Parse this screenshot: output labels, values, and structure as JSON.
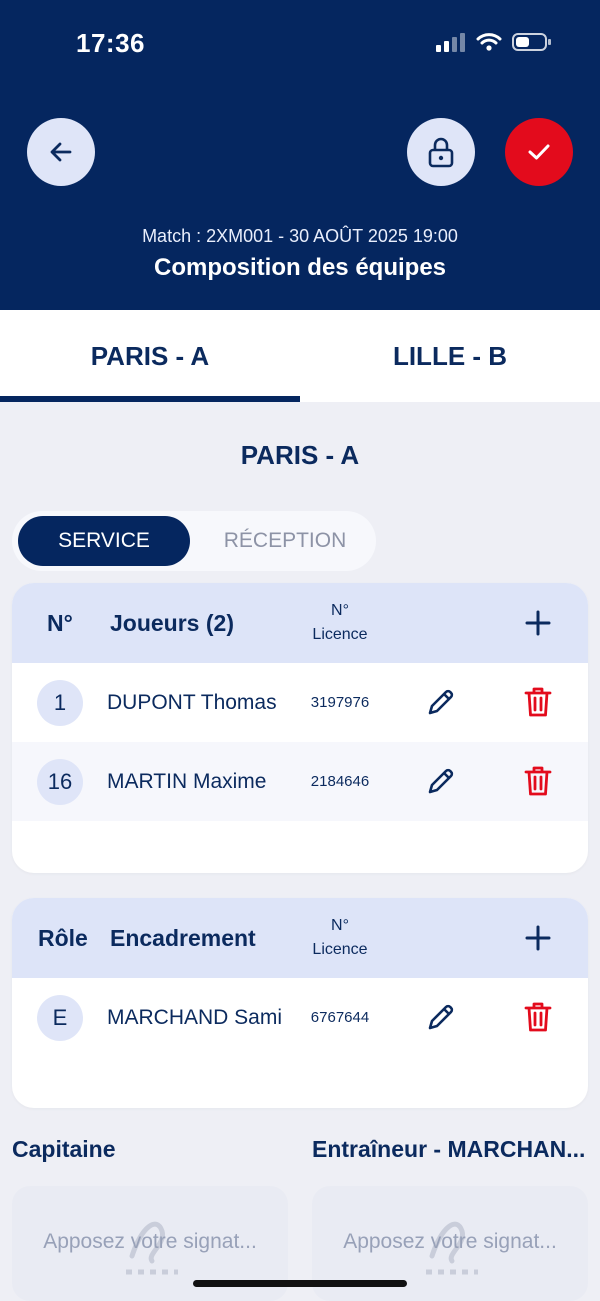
{
  "status_bar": {
    "time": "17:36"
  },
  "header": {
    "match_line": "Match : 2XM001 - 30 AOÛT 2025 19:00",
    "title": "Composition des équipes",
    "back_icon": "arrow-left-icon",
    "lock_icon": "lock-icon",
    "confirm_icon": "check-icon"
  },
  "tabs": [
    {
      "label": "PARIS - A",
      "active": true
    },
    {
      "label": "LILLE - B",
      "active": false
    }
  ],
  "team_heading": "PARIS - A",
  "segmented": {
    "service": "SERVICE",
    "reception": "RÉCEPTION",
    "selected": "SERVICE"
  },
  "players": {
    "col_number": "N°",
    "col_title": "Joueurs (2)",
    "col_licence_1": "N°",
    "col_licence_2": "Licence",
    "rows": [
      {
        "number": "1",
        "name": "DUPONT Thomas",
        "licence": "3197976"
      },
      {
        "number": "16",
        "name": "MARTIN Maxime",
        "licence": "2184646"
      }
    ]
  },
  "staff": {
    "col_role": "Rôle",
    "col_title": "Encadrement",
    "col_licence_1": "N°",
    "col_licence_2": "Licence",
    "rows": [
      {
        "role": "E",
        "name": "MARCHAND Sami",
        "licence": "6767644"
      }
    ]
  },
  "signatures": {
    "captain_label": "Capitaine",
    "coach_label": "Entraîneur - MARCHAN...",
    "placeholder": "Apposez votre signat..."
  },
  "colors": {
    "primary": "#05265f",
    "danger": "#e30b1c",
    "light": "#dde4f8"
  }
}
